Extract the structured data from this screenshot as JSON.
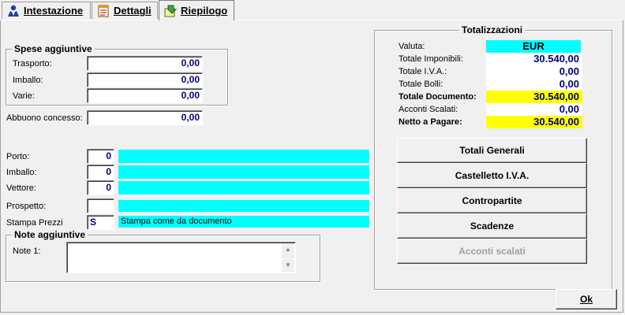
{
  "tabs": [
    {
      "label": "Intestazione",
      "icon": "user-icon"
    },
    {
      "label": "Dettagli",
      "icon": "document-icon"
    },
    {
      "label": "Riepilogo",
      "icon": "summary-icon"
    }
  ],
  "spese": {
    "title": "Spese aggiuntive",
    "trasporto_label": "Trasporto:",
    "trasporto_value": "0,00",
    "imballo_label": "Imballo:",
    "imballo_value": "0,00",
    "varie_label": "Varie:",
    "varie_value": "0,00"
  },
  "abbuono": {
    "label": "Abbuono concesso:",
    "value": "0,00"
  },
  "shipping": {
    "porto_label": "Porto:",
    "porto_value": "0",
    "porto_desc": "",
    "imballo_label": "Imballo:",
    "imballo_value": "0",
    "imballo_desc": "",
    "vettore_label": "Vettore:",
    "vettore_value": "0",
    "vettore_desc": "",
    "prospetto_label": "Prospetto:",
    "prospetto_value": "",
    "prospetto_desc": "",
    "stampa_label": "Stampa Prezzi",
    "stampa_value": "S",
    "stampa_desc": "Stampa come da documento"
  },
  "note": {
    "title": "Note aggiuntive",
    "note1_label": "Note 1:",
    "note1_value": ""
  },
  "totali": {
    "title": "Totalizzazioni",
    "valuta_label": "Valuta:",
    "valuta_value": "EUR",
    "imponibili_label": "Totale Imponibili:",
    "imponibili_value": "30.540,00",
    "iva_label": "Totale I.V.A.:",
    "iva_value": "0,00",
    "bolli_label": "Totale Bolli:",
    "bolli_value": "0,00",
    "documento_label": "Totale Documento:",
    "documento_value": "30.540,00",
    "acconti_label": "Acconti Scalati:",
    "acconti_value": "0,00",
    "netto_label": "Netto a Pagare:",
    "netto_value": "30.540,00"
  },
  "buttons": {
    "totali_generali": "Totali Generali",
    "castelletto": "Castelletto I.V.A.",
    "contropartite": "Contropartite",
    "scadenze": "Scadenze",
    "acconti_scalati": "Acconti scalati",
    "ok": "Ok"
  },
  "colors": {
    "highlight_yellow": "#ffff00",
    "cyan": "#00ffff",
    "value_blue": "#00007a"
  }
}
